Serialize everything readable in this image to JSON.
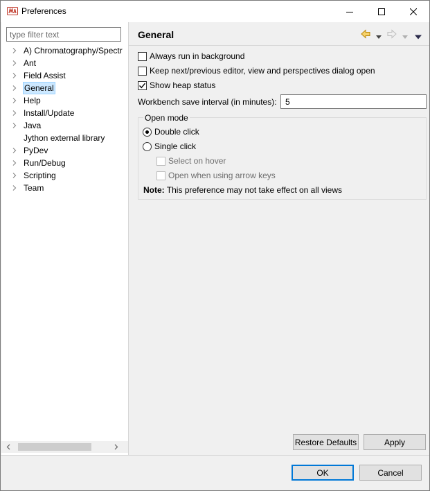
{
  "window": {
    "title": "Preferences",
    "accent": "#0078d7"
  },
  "sidebar": {
    "filter_placeholder": "type filter text",
    "items": [
      {
        "label": "A) Chromatography/Spectrometry",
        "expandable": true,
        "selected": false
      },
      {
        "label": "Ant",
        "expandable": true,
        "selected": false
      },
      {
        "label": "Field Assist",
        "expandable": true,
        "selected": false
      },
      {
        "label": "General",
        "expandable": true,
        "selected": true
      },
      {
        "label": "Help",
        "expandable": true,
        "selected": false
      },
      {
        "label": "Install/Update",
        "expandable": true,
        "selected": false
      },
      {
        "label": "Java",
        "expandable": true,
        "selected": false
      },
      {
        "label": "Jython external library",
        "expandable": false,
        "selected": false
      },
      {
        "label": "PyDev",
        "expandable": true,
        "selected": false
      },
      {
        "label": "Run/Debug",
        "expandable": true,
        "selected": false
      },
      {
        "label": "Scripting",
        "expandable": true,
        "selected": false
      },
      {
        "label": "Team",
        "expandable": true,
        "selected": false
      }
    ]
  },
  "page": {
    "title": "General",
    "options": {
      "always_run_bg": {
        "label": "Always run in background",
        "checked": false
      },
      "keep_dialog_open": {
        "label": "Keep next/previous editor, view and perspectives dialog open",
        "checked": false
      },
      "show_heap": {
        "label": "Show heap status",
        "checked": true
      }
    },
    "save_interval": {
      "label": "Workbench save interval (in minutes):",
      "value": "5"
    },
    "open_mode": {
      "legend": "Open mode",
      "double_click": {
        "label": "Double click",
        "selected": true
      },
      "single_click": {
        "label": "Single click",
        "selected": false
      },
      "select_on_hover": {
        "label": "Select on hover",
        "enabled": false
      },
      "open_arrow_keys": {
        "label": "Open when using arrow keys",
        "enabled": false
      }
    },
    "note": {
      "prefix": "Note:",
      "text": " This preference may not take effect on all views"
    },
    "restore_defaults": "Restore Defaults",
    "apply": "Apply"
  },
  "footer": {
    "ok": "OK",
    "cancel": "Cancel"
  },
  "icons": {
    "app": "eclipse-app-icon",
    "back": "back-arrow-icon",
    "forward": "forward-arrow-icon",
    "menu": "view-menu-icon"
  }
}
